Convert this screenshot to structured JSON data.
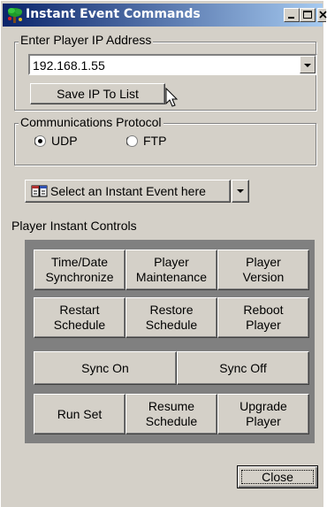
{
  "window": {
    "title": "Instant Event Commands",
    "icons": {
      "app": "tree-icon",
      "minimize": "minimize-icon",
      "maximize": "maximize-icon",
      "close": "close-icon"
    }
  },
  "ip_group": {
    "label": "Enter Player IP Address",
    "ip_value": "192.168.1.55",
    "save_button": "Save IP To List"
  },
  "protocol_group": {
    "label": "Communications Protocol",
    "options": [
      {
        "label": "UDP",
        "selected": true
      },
      {
        "label": "FTP",
        "selected": false
      }
    ]
  },
  "event_select": {
    "label": "Select an Instant Event here",
    "icon": "event-calendar-icon"
  },
  "instant_controls": {
    "label": "Player Instant Controls",
    "rows": [
      [
        "Time/Date\nSynchronize",
        "Player\nMaintenance",
        "Player\nVersion"
      ],
      [
        "Restart\nSchedule",
        "Restore\nSchedule",
        "Reboot\nPlayer"
      ],
      [
        "Sync On",
        "Sync Off"
      ],
      [
        "Run Set",
        "Resume\nSchedule",
        "Upgrade\nPlayer"
      ]
    ]
  },
  "close_button": "Close",
  "colors": {
    "title_start": "#0a246a",
    "title_end": "#a6caf0",
    "face": "#d4d0c8",
    "panel": "#808080"
  }
}
